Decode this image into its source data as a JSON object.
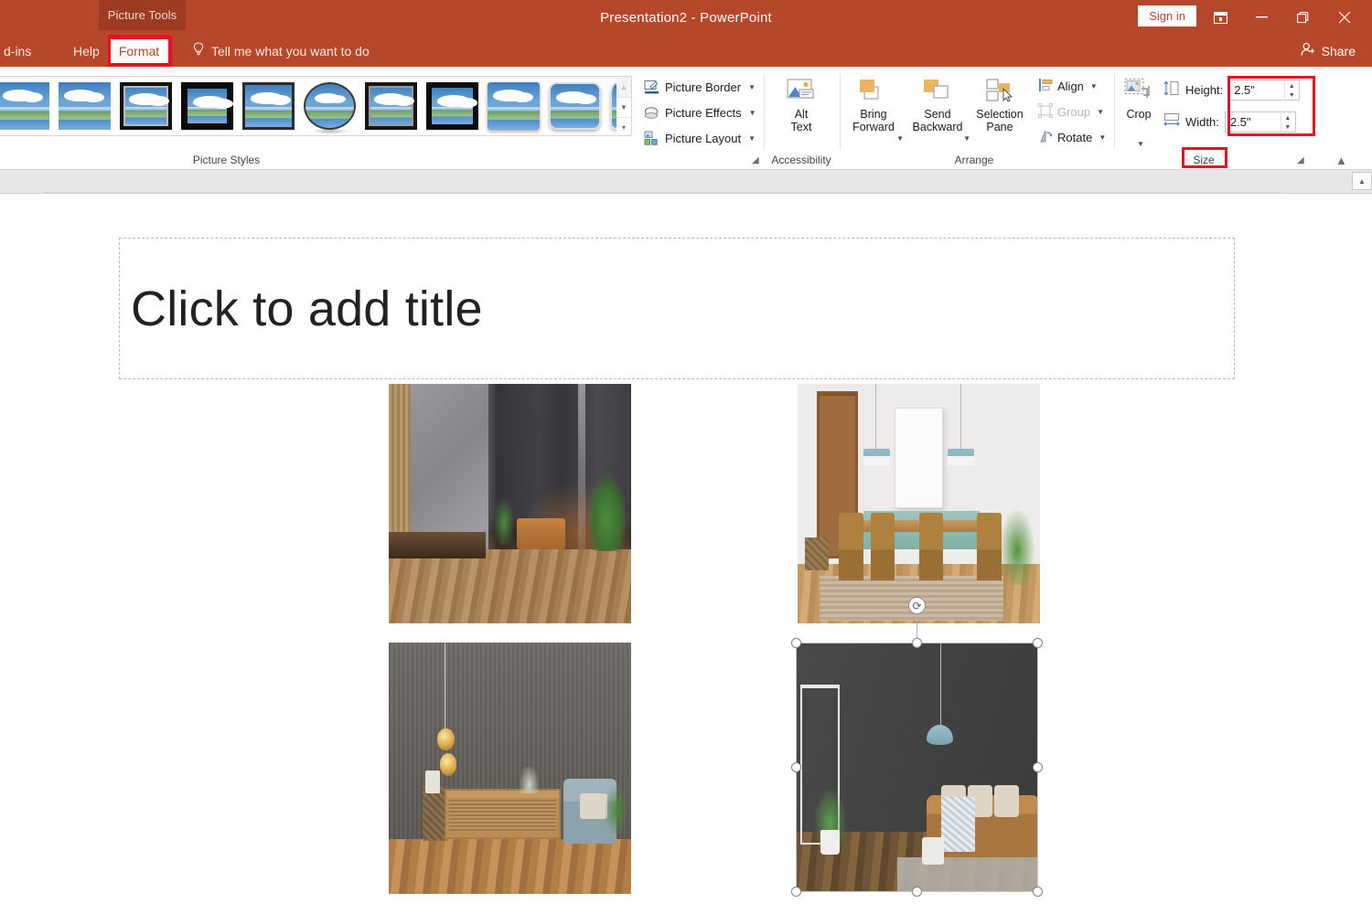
{
  "window": {
    "contextual_tab": "Picture Tools",
    "title": "Presentation2  -  PowerPoint",
    "sign_in": "Sign in",
    "ribbon_display_options_icon": "ribbon-display-options-icon",
    "minimize_icon": "minimize-icon",
    "restore_icon": "restore-icon",
    "close_icon": "close-icon"
  },
  "tabs": {
    "addins": "d-ins",
    "help": "Help",
    "format": "Format",
    "tell_me": "Tell me what you want to do",
    "tell_me_icon": "lightbulb-icon",
    "share": "Share",
    "share_icon": "share-person-icon"
  },
  "ribbon": {
    "groups": {
      "picture_styles": "Picture Styles",
      "accessibility": "Accessibility",
      "arrange": "Arrange",
      "size": "Size"
    },
    "gallery": {
      "items": [
        "simple-frame-white",
        "beveled-matte-white",
        "metal-frame",
        "drop-shadow-rectangle",
        "reflected-rounded-rectangle",
        "soft-edge-oval",
        "double-frame-black",
        "thick-matte-black",
        "simple-frame-black",
        "bevel-rectangle",
        "reflected-perspective-right"
      ],
      "scroll_up": "scroll-up",
      "scroll_down": "scroll-down",
      "more": "more-styles"
    },
    "picture_border": "Picture Border",
    "picture_effects": "Picture Effects",
    "picture_layout": "Picture Layout",
    "alt_text": "Alt\nText",
    "alt_text_line1": "Alt",
    "alt_text_line2": "Text",
    "bring_forward_line1": "Bring",
    "bring_forward_line2": "Forward",
    "send_backward_line1": "Send",
    "send_backward_line2": "Backward",
    "selection_pane_line1": "Selection",
    "selection_pane_line2": "Pane",
    "align": "Align",
    "group": "Group",
    "rotate": "Rotate",
    "crop": "Crop",
    "height_label": "Height:",
    "height_value": "2.5\"",
    "width_label": "Width:",
    "width_value": "2.5\"",
    "dialog_launcher": "dialog-box-launcher",
    "collapse_ribbon": "collapse-ribbon"
  },
  "slide": {
    "title_placeholder": "Click to add title",
    "pictures": [
      {
        "name": "picture-grey-concrete-loft",
        "selected": false
      },
      {
        "name": "picture-dining-room",
        "selected": false
      },
      {
        "name": "picture-dark-wall-sideboard",
        "selected": false
      },
      {
        "name": "picture-dark-wall-living-room",
        "selected": true
      }
    ]
  },
  "annotations": {
    "format_tab_highlight": "red-box-format-tab",
    "size_fields_highlight": "red-box-size-fields",
    "size_group_highlight": "red-box-size-label"
  },
  "colors": {
    "accent": "#b7472a",
    "contextual_tab": "#9c3a22",
    "annotation": "#e81123",
    "ribbon_bg": "#ffffff"
  }
}
